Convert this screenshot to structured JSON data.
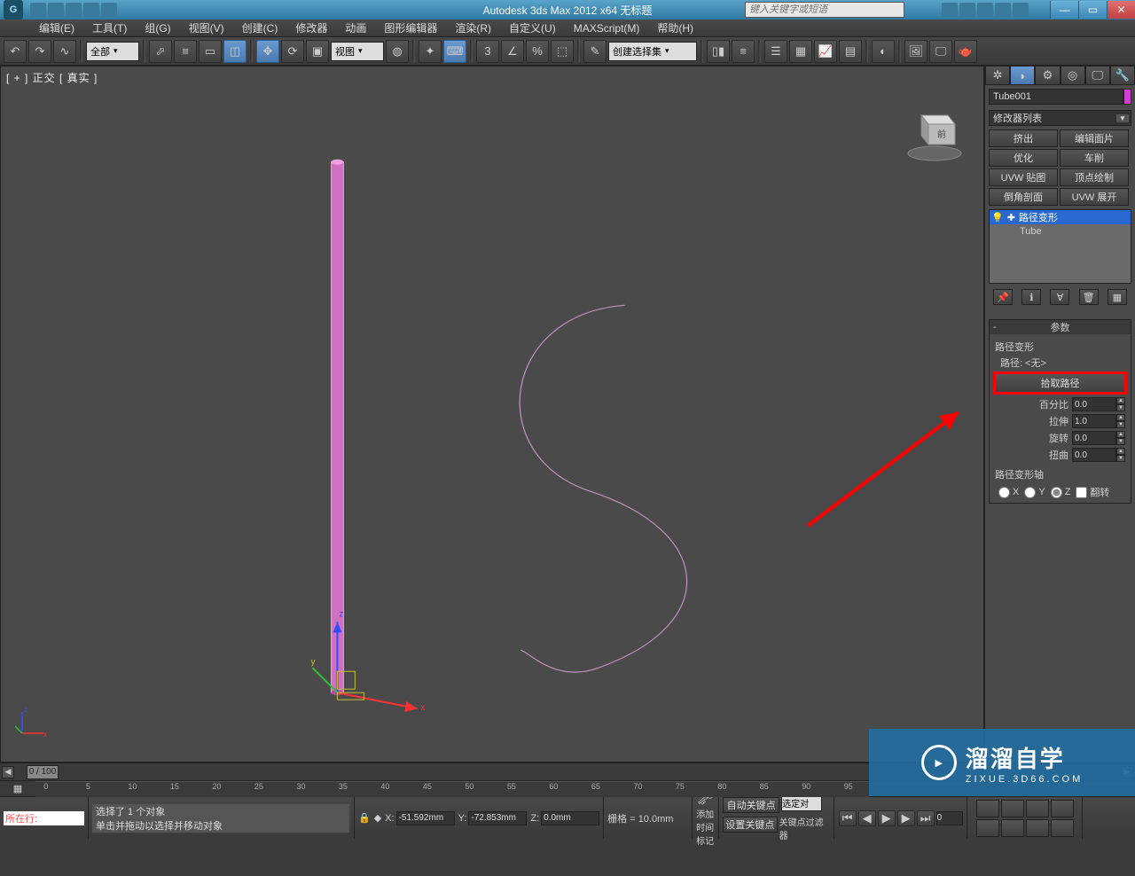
{
  "titlebar": {
    "app_title": "Autodesk 3ds Max  2012 x64     无标题",
    "search_placeholder": "键入关键字或短语"
  },
  "menus": [
    "编辑(E)",
    "工具(T)",
    "组(G)",
    "视图(V)",
    "创建(C)",
    "修改器",
    "动画",
    "图形编辑器",
    "渲染(R)",
    "自定义(U)",
    "MAXScript(M)",
    "帮助(H)"
  ],
  "toolbar": {
    "filter_dd": "全部",
    "view_dd": "视图",
    "snap_val": "3",
    "selection_set_dd": "创建选择集"
  },
  "viewport": {
    "label": "[ + ] 正交 [ 真实 ]",
    "cube_face": "前"
  },
  "cmdpanel": {
    "object_name": "Tube001",
    "modlist_dd": "修改器列表",
    "mod_buttons": [
      "挤出",
      "编辑面片",
      "优化",
      "车削",
      "UVW 贴图",
      "顶点绘制",
      "倒角剖面",
      "UVW 展开"
    ],
    "stack": [
      "路径变形",
      "Tube"
    ]
  },
  "params": {
    "head": "参数",
    "group1": "路径变形",
    "path_label": "路径: <无>",
    "pick_btn": "拾取路径",
    "pct_label": "百分比",
    "pct_val": "0.0",
    "stretch_label": "拉伸",
    "stretch_val": "1.0",
    "rot_label": "旋转",
    "rot_val": "0.0",
    "twist_label": "扭曲",
    "twist_val": "0.0",
    "axis_group": "路径变形轴",
    "axis_x": "X",
    "axis_y": "Y",
    "axis_z": "Z",
    "flip": "翻转"
  },
  "timeline": {
    "frame_label": "0 / 100",
    "ticks": [
      0,
      5,
      10,
      15,
      20,
      25,
      30,
      35,
      40,
      45,
      50,
      55,
      60,
      65,
      70,
      75,
      80,
      85,
      90,
      95
    ]
  },
  "status": {
    "selection": "选择了 1 个对象",
    "prompt": "单击并拖动以选择并移动对象",
    "x": "-51.592mm",
    "y": "-72.853mm",
    "z": "0.0mm",
    "grid": "栅格 = 10.0mm",
    "autokey": "自动关键点",
    "selected_only": "选定对",
    "setkey": "设置关键点",
    "keyfilter": "关键点过滤器",
    "playpos": "0",
    "addtag": "添加时间标记",
    "location": "所在行:"
  },
  "watermark": {
    "cn": "溜溜自学",
    "en": "ZIXUE.3D66.COM"
  }
}
